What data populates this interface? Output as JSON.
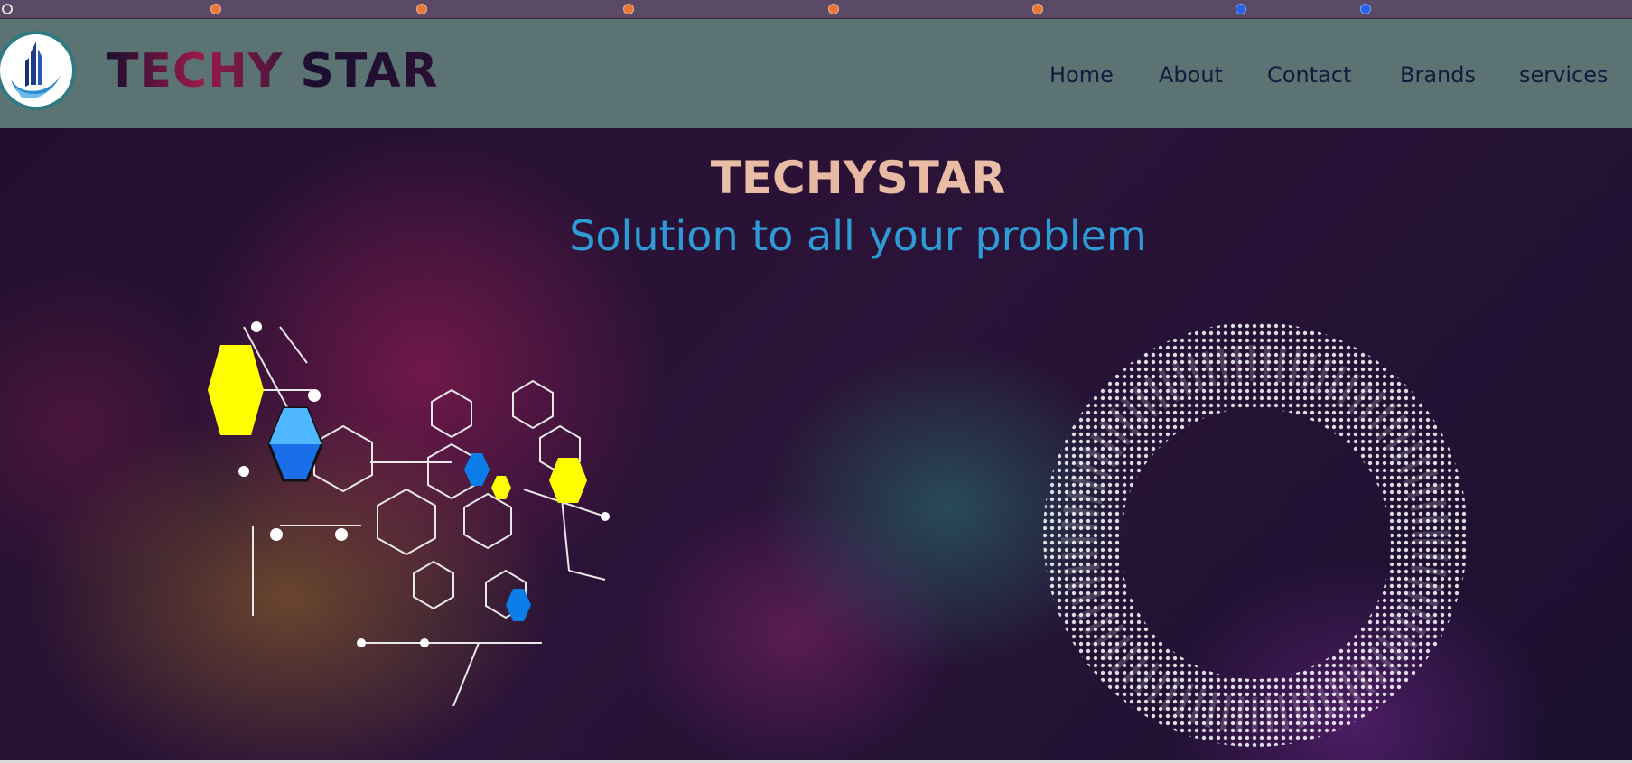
{
  "site": {
    "brand_name": "TECHY STAR"
  },
  "navigation": {
    "links": [
      {
        "label": "Home"
      },
      {
        "label": "About"
      },
      {
        "label": "Contact"
      },
      {
        "label": "Brands"
      },
      {
        "label": "services"
      }
    ]
  },
  "hero": {
    "title": "TECHYSTAR",
    "subtitle": "Solution to all your problem"
  },
  "colors": {
    "navbar_bg": "#5b7373",
    "nav_text": "#121d3e",
    "subtitle": "#2e9ad6",
    "hex_yellow": "#ffff00",
    "hex_blue": "#0a7de8"
  },
  "icons": {
    "logo": "tower-flame-logo-icon",
    "left_graphic": "hexagon-network-graphic",
    "right_graphic": "dotted-ring-graphic"
  }
}
